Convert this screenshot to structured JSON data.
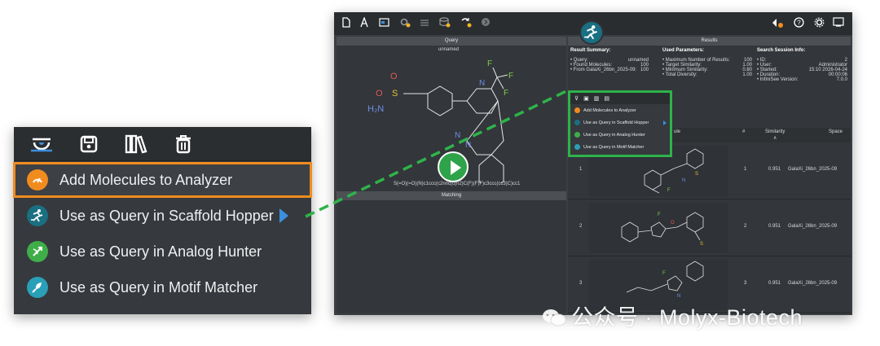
{
  "zoom_menu": {
    "items": [
      {
        "label": "Add Molecules to Analyzer",
        "icon": "analyzer-icon",
        "color": "#f08c1e"
      },
      {
        "label": "Use as Query in Scaffold Hopper",
        "icon": "scaffold-hopper-icon",
        "color": "#1a6f82"
      },
      {
        "label": "Use as Query in Analog Hunter",
        "icon": "analog-hunter-icon",
        "color": "#3fae49"
      },
      {
        "label": "Use as Query in Motif Matcher",
        "icon": "motif-matcher-icon",
        "color": "#2a9fb8"
      }
    ],
    "highlight_color": "#f08c1e",
    "toolbar_icons": [
      "deselect-icon",
      "save-icon",
      "library-icon",
      "trash-icon"
    ]
  },
  "app": {
    "query_header": "Query",
    "query_name": "unnamed",
    "smiles": "S(=O)(=O)(N)c1ccc(c2nnc(c(n2)C(F)(F)F)c3ccc(cc3)C)cc1",
    "matching_header": "Matching",
    "results_header": "Results",
    "molecule_labels": {
      "O_top": "O",
      "S": "S",
      "O_left": "O",
      "H2N": "H₂N",
      "N1": "N",
      "N2": "N",
      "N3": "N",
      "F1": "F",
      "F2": "F",
      "F3": "F"
    },
    "summary": {
      "title": "Result Summary:",
      "rows": [
        {
          "label": "• Query:",
          "value": "unnamed"
        },
        {
          "label": "• Found Molecules:",
          "value": "100"
        },
        {
          "label": "• From GalaXi_26bn_2025-09:",
          "value": "100"
        }
      ]
    },
    "parameters": {
      "title": "Used Parameters:",
      "rows": [
        {
          "label": "• Maximum Number of Results:",
          "value": "100"
        },
        {
          "label": "• Target Similarity:",
          "value": "1.00"
        },
        {
          "label": "• Minimum Similarity:",
          "value": "0.80"
        },
        {
          "label": "• Total Diversity:",
          "value": "1.00"
        }
      ]
    },
    "session": {
      "title": "Search Session Info:",
      "rows": [
        {
          "label": "• ID:",
          "value": "2"
        },
        {
          "label": "• User:",
          "value": "Administrator"
        },
        {
          "label": "• Started:",
          "value": "15:10 2026-04-24"
        },
        {
          "label": "• Duration:",
          "value": "00:00:06"
        },
        {
          "label": "• InfiniSee Version:",
          "value": "7.0.0"
        }
      ]
    },
    "table": {
      "headers": {
        "molecule": "ule",
        "number": "#",
        "similarity": "Similarity",
        "space": "Space"
      },
      "sort_indicator": "∧",
      "rows": [
        {
          "index": "1",
          "number": "1",
          "similarity": "0.951",
          "space": "GalaXi_26bn_2025-09"
        },
        {
          "index": "2",
          "number": "2",
          "similarity": "0.951",
          "space": "GalaXi_26bn_2025-09"
        },
        {
          "index": "3",
          "number": "3",
          "similarity": "0.951",
          "space": "GalaXi_26bn_2025-09"
        }
      ]
    },
    "small_menu": {
      "items": [
        {
          "label": "Add Molecules to Analyzer",
          "color": "#f08c1e"
        },
        {
          "label": "Use as Query in Scaffold Hopper",
          "color": "#1a6f82"
        },
        {
          "label": "Use as Query in Analog Hunter",
          "color": "#3fae49"
        },
        {
          "label": "Use as Query in Motif Matcher",
          "color": "#2a9fb8"
        }
      ],
      "border_color": "#2eb34a"
    }
  },
  "watermark": "公众号 · Molyx-Biotech"
}
